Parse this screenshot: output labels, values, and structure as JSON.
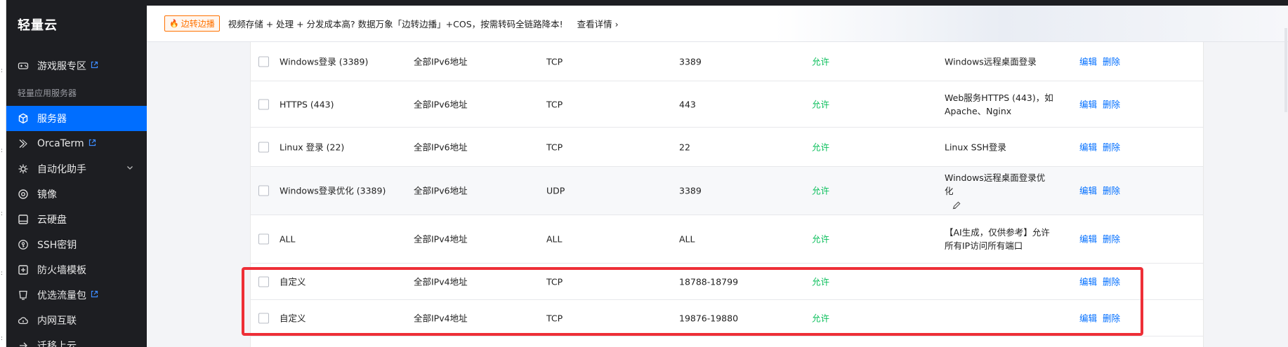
{
  "app": {
    "title": "轻量云"
  },
  "sidebar": {
    "group_label": "轻量应用服务器",
    "items": [
      {
        "label": "游戏服专区",
        "icon": "gamepad-icon",
        "external": true
      },
      {
        "label": "服务器",
        "icon": "cube-icon",
        "active": true
      },
      {
        "label": "OrcaTerm",
        "icon": "terminal-icon",
        "external": true
      },
      {
        "label": "自动化助手",
        "icon": "automation-icon",
        "expandable": true
      },
      {
        "label": "镜像",
        "icon": "image-icon"
      },
      {
        "label": "云硬盘",
        "icon": "disk-icon"
      },
      {
        "label": "SSH密钥",
        "icon": "key-icon"
      },
      {
        "label": "防火墙模板",
        "icon": "shield-icon"
      },
      {
        "label": "优选流量包",
        "icon": "traffic-icon",
        "external": true
      },
      {
        "label": "内网互联",
        "icon": "network-icon"
      },
      {
        "label": "迁移上云",
        "icon": "migrate-icon"
      }
    ]
  },
  "banner": {
    "badge": "边转边播",
    "text": "视频存储 + 处理 + 分发成本高? 数据万象「边转边播」+COS，按需转码全链路降本!",
    "link": "查看详情"
  },
  "table": {
    "actions": {
      "edit": "编辑",
      "delete": "删除"
    },
    "rows": [
      {
        "name": "Windows登录 (3389)",
        "source": "全部IPv6地址",
        "protocol": "TCP",
        "port": "3389",
        "policy": "允许",
        "note": "Windows远程桌面登录"
      },
      {
        "name": "HTTPS (443)",
        "source": "全部IPv6地址",
        "protocol": "TCP",
        "port": "443",
        "policy": "允许",
        "note": "Web服务HTTPS (443)，如Apache、Nginx"
      },
      {
        "name": "Linux 登录 (22)",
        "source": "全部IPv6地址",
        "protocol": "TCP",
        "port": "22",
        "policy": "允许",
        "note": "Linux SSH登录"
      },
      {
        "name": "Windows登录优化 (3389)",
        "source": "全部IPv6地址",
        "protocol": "UDP",
        "port": "3389",
        "policy": "允许",
        "note": "Windows远程桌面登录优化"
      },
      {
        "name": "ALL",
        "source": "全部IPv4地址",
        "protocol": "ALL",
        "port": "ALL",
        "policy": "允许",
        "note": "【AI生成，仅供参考】允许所有IP访问所有端口"
      },
      {
        "name": "自定义",
        "source": "全部IPv4地址",
        "protocol": "TCP",
        "port": "18788-18799",
        "policy": "允许",
        "note": ""
      },
      {
        "name": "自定义",
        "source": "全部IPv4地址",
        "protocol": "TCP",
        "port": "19876-19880",
        "policy": "允许",
        "note": ""
      }
    ]
  },
  "colors": {
    "accent": "#006eff",
    "allow": "#0abf5b",
    "highlight": "#ee2f37",
    "badge": "#ff7200"
  }
}
